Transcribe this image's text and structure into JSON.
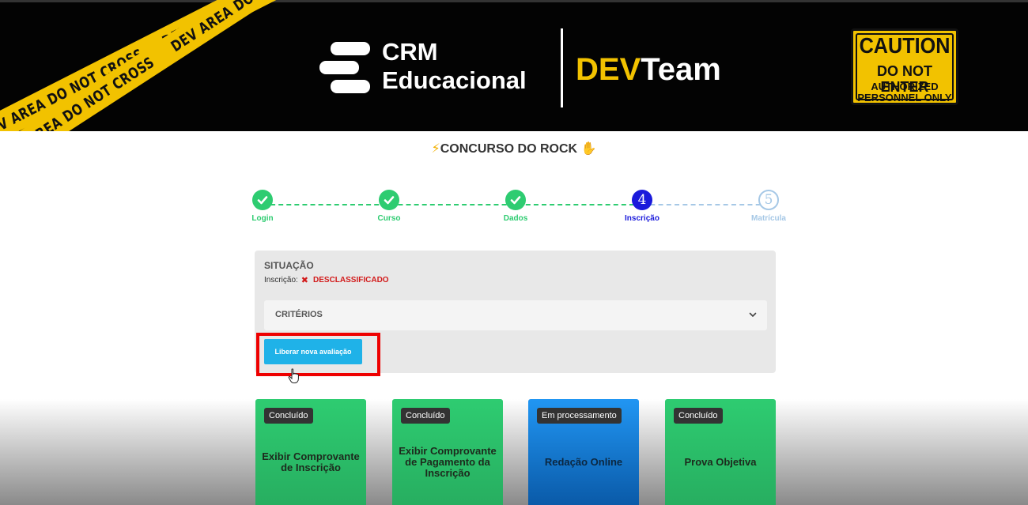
{
  "banner": {
    "tape_text": "DEV AREA DO NOT CROSS",
    "logo_line1": "CRM",
    "logo_line2": "Educacional",
    "devteam_dev": "DEV",
    "devteam_team": "Team",
    "caution_title": "CAUTION",
    "caution_line2": "DO NOT ENTER",
    "caution_line3": "AUTHORIZED",
    "caution_line4": "PERSONNEL ONLY"
  },
  "page": {
    "title": "CONCURSO DO ROCK"
  },
  "stepper": {
    "steps": [
      {
        "label": "Login",
        "state": "done"
      },
      {
        "label": "Curso",
        "state": "done"
      },
      {
        "label": "Dados",
        "state": "done"
      },
      {
        "label": "Inscrição",
        "state": "active",
        "number": "4"
      },
      {
        "label": "Matrícula",
        "state": "todo",
        "number": "5"
      }
    ]
  },
  "situation": {
    "title": "SITUAÇÃO",
    "label": "Inscrição:",
    "status": "DESCLASSIFICADO",
    "criteria_label": "CRITÉRIOS",
    "release_button": "Liberar nova avaliação"
  },
  "cards": [
    {
      "badge": "Concluído",
      "title": "Exibir Comprovante de Inscrição",
      "color": "#2ecc71"
    },
    {
      "badge": "Concluído",
      "title": "Exibir Comprovante de Pagamento da Inscrição",
      "color": "#2ecc71"
    },
    {
      "badge": "Em processamento",
      "title": "Redação Online",
      "color": "#2196f3"
    },
    {
      "badge": "Concluído",
      "title": "Prova Objetiva",
      "color": "#2ecc71"
    }
  ],
  "colors": {
    "accent_yellow": "#f2c200",
    "done_green": "#2ecc71",
    "active_blue": "#1a1adb",
    "error_red": "#d21a1a",
    "button_cyan": "#1fb2e8"
  }
}
